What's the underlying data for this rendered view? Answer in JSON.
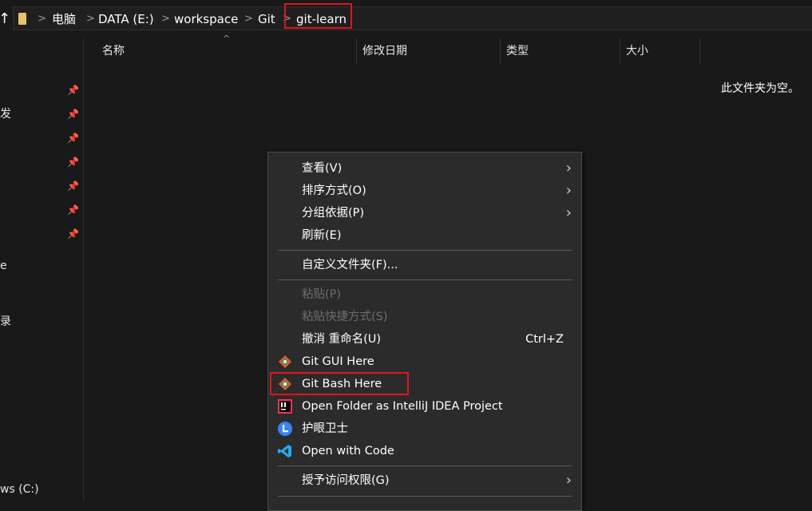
{
  "address_bar": {
    "crumbs": [
      "电脑",
      "DATA (E:)",
      "workspace",
      "Git",
      "git-learn"
    ],
    "separator": ">"
  },
  "nav": {
    "fragments": [
      "发",
      "e",
      "录",
      "ws (C:)"
    ],
    "pin_count": 7,
    "up_arrow": "↑"
  },
  "columns": {
    "name": "名称",
    "modified": "修改日期",
    "type": "类型",
    "size": "大小"
  },
  "empty_message": "此文件夹为空。",
  "context_menu": {
    "items": [
      {
        "label": "查看(V)",
        "submenu": true
      },
      {
        "label": "排序方式(O)",
        "submenu": true
      },
      {
        "label": "分组依据(P)",
        "submenu": true
      },
      {
        "label": "刷新(E)"
      },
      {
        "label": "自定义文件夹(F)..."
      },
      {
        "label": "粘贴(P)",
        "disabled": true
      },
      {
        "label": "粘贴快捷方式(S)",
        "disabled": true
      },
      {
        "label": "撤消 重命名(U)",
        "shortcut": "Ctrl+Z"
      },
      {
        "label": "Git GUI Here",
        "icon": "git-gui-icon"
      },
      {
        "label": "Git Bash Here",
        "icon": "git-bash-icon"
      },
      {
        "label": "Open Folder as IntelliJ IDEA Project",
        "icon": "intellij-icon"
      },
      {
        "label": "护眼卫士",
        "icon": "eye-guard-icon"
      },
      {
        "label": "Open with Code",
        "icon": "vscode-icon"
      },
      {
        "label": "授予访问权限(G)",
        "submenu": true
      }
    ],
    "chevron": "›"
  },
  "colors": {
    "background": "#191919",
    "menu_bg": "#2b2b2b",
    "highlight_red": "#e0141e"
  }
}
